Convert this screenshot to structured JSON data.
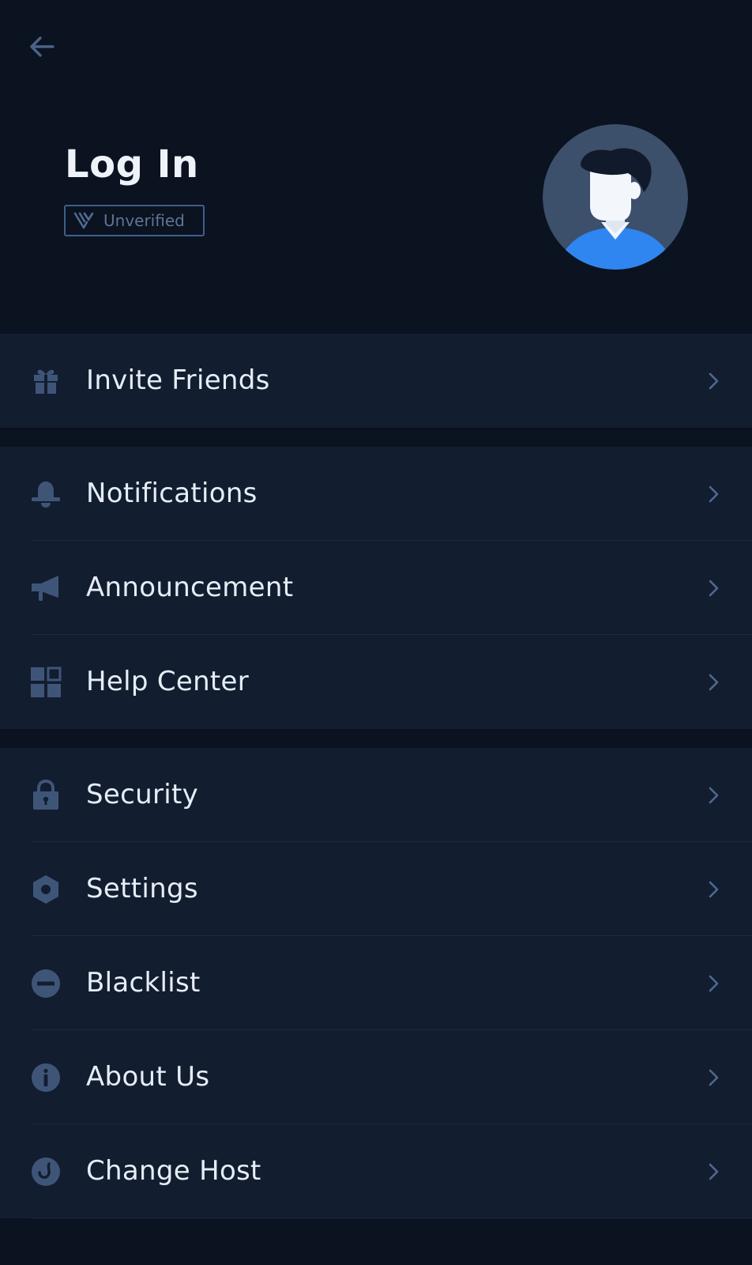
{
  "header": {
    "title": "Log In",
    "badge_label": "Unverified",
    "back_icon": "arrow-left-icon",
    "avatar_icon": "user-avatar-icon"
  },
  "colors": {
    "background": "#0b1220",
    "row_background": "#121d2f",
    "icon": "#3f5578",
    "text": "#e6edf6",
    "avatar_bg": "#3c4f6b",
    "avatar_shirt": "#2f86f0",
    "badge_border": "#3f5f8a"
  },
  "menu": {
    "groups": [
      {
        "items": [
          {
            "label": "Invite Friends",
            "icon": "gift-icon"
          }
        ]
      },
      {
        "items": [
          {
            "label": "Notifications",
            "icon": "bell-icon"
          },
          {
            "label": "Announcement",
            "icon": "megaphone-icon"
          },
          {
            "label": "Help Center",
            "icon": "grid-icon"
          }
        ]
      },
      {
        "items": [
          {
            "label": "Security",
            "icon": "lock-icon"
          },
          {
            "label": "Settings",
            "icon": "hexagon-gear-icon"
          },
          {
            "label": "Blacklist",
            "icon": "minus-circle-icon"
          },
          {
            "label": "About Us",
            "icon": "info-icon"
          },
          {
            "label": "Change Host",
            "icon": "host-icon"
          }
        ]
      }
    ]
  }
}
